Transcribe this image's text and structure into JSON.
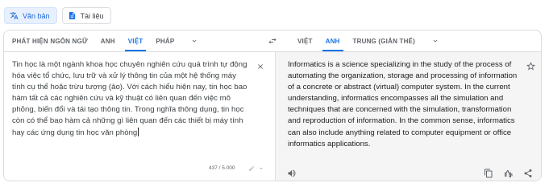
{
  "modes": [
    {
      "label": "Văn bản",
      "active": true,
      "icon": "translate-icon"
    },
    {
      "label": "Tài liệu",
      "active": false,
      "icon": "document-icon"
    }
  ],
  "source_langs": [
    "PHÁT HIỆN NGÔN NGỮ",
    "ANH",
    "VIỆT",
    "PHÁP"
  ],
  "source_active_index": 2,
  "target_langs": [
    "VIỆT",
    "ANH",
    "TRUNG (GIẢN THỂ)"
  ],
  "target_active_index": 1,
  "source_text": "Tin học là một ngành khoa học chuyên nghiên cứu quá trình tự động hóa việc tổ chức, lưu trữ và xử lý thông tin của một hệ thống máy tính cụ thể hoặc trừu tượng (ảo). Với cách hiểu hiện nay, tin học bao hàm tất cả các nghiên cứu và kỹ thuật có liên quan đến việc mô phỏng, biến đổi và tái tạo thông tin. Trong nghĩa thông dụng, tin học còn có thể bao hàm cả những gì liên quan đến các thiết bị máy tính hay các ứng dụng tin học văn phòng",
  "translated_text": "Informatics is a science specializing in the study of the process of automating the organization, storage and processing of information of a concrete or abstract (virtual) computer system. In the current understanding, informatics encompasses all the simulation and techniques that are concerned with the simulation, transformation and reproduction of information. In the common sense, informatics can also include anything related to computer equipment or office informatics applications.",
  "char_count": "437 / 5.000",
  "colors": {
    "accent": "#1a73e8",
    "icon": "#5f6368",
    "target_bg": "#f5f5f5"
  }
}
